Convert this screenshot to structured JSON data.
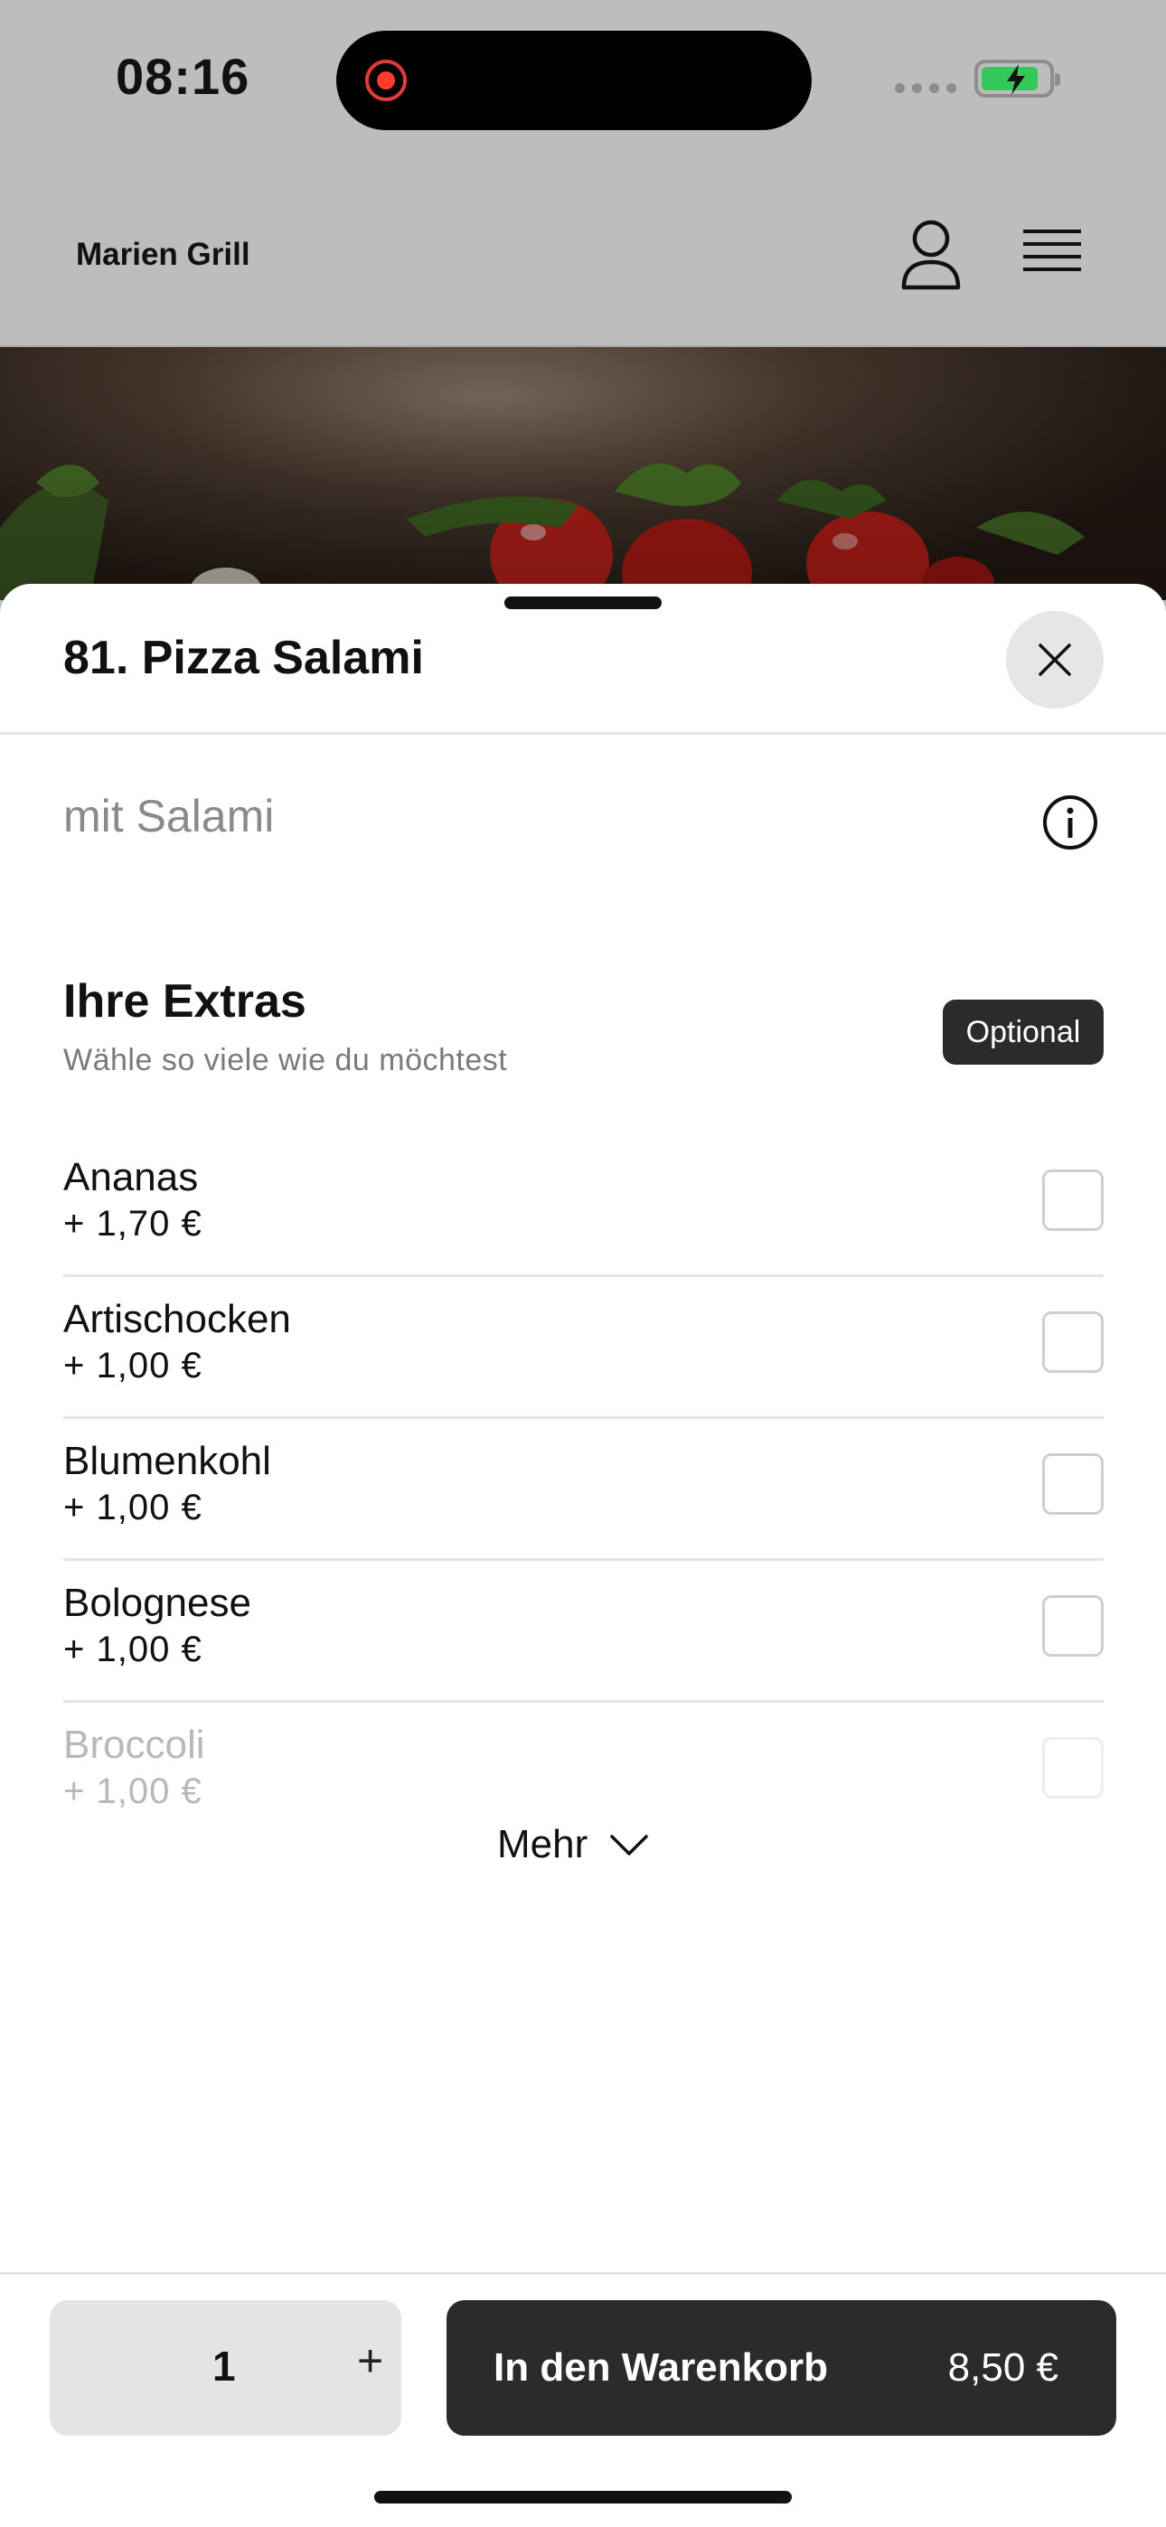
{
  "status_bar": {
    "time": "08:16"
  },
  "header": {
    "brand": "Marien Grill"
  },
  "sheet": {
    "title": "81. Pizza Salami",
    "description": "mit Salami"
  },
  "extras": {
    "title": "Ihre Extras",
    "subtitle": "Wähle so viele wie du möchtest",
    "badge": "Optional",
    "options": [
      {
        "name": "Ananas",
        "price": "+ 1,70 €"
      },
      {
        "name": "Artischocken",
        "price": "+ 1,00 €"
      },
      {
        "name": "Blumenkohl",
        "price": "+ 1,00 €"
      },
      {
        "name": "Bolognese",
        "price": "+ 1,00 €"
      },
      {
        "name": "Broccoli",
        "price": "+ 1,00 €"
      }
    ],
    "more_label": "Mehr"
  },
  "footer": {
    "quantity": "1",
    "plus": "+",
    "cart_label": "In den Warenkorb",
    "cart_price": "8,50 €"
  }
}
